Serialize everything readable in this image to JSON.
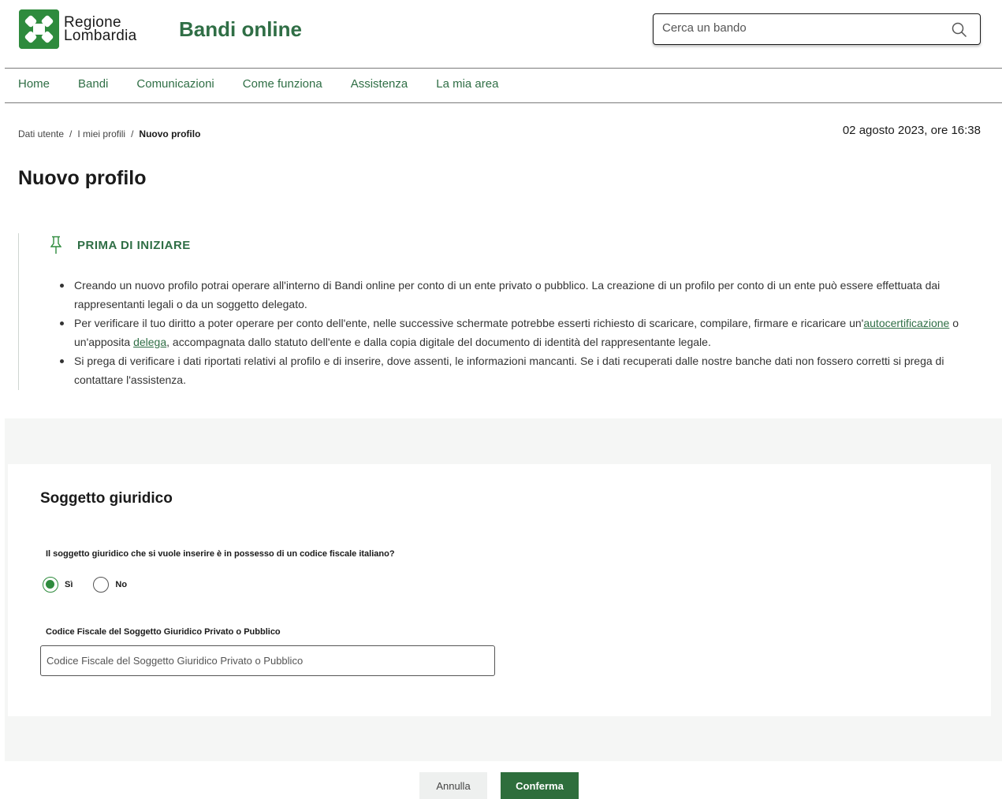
{
  "header": {
    "logo_line1": "Regione",
    "logo_line2": "Lombardia",
    "site_title": "Bandi online",
    "search_placeholder": "Cerca un bando"
  },
  "nav": {
    "items": [
      {
        "label": "Home"
      },
      {
        "label": "Bandi"
      },
      {
        "label": "Comunicazioni"
      },
      {
        "label": "Come funziona"
      },
      {
        "label": "Assistenza"
      },
      {
        "label": "La mia area"
      }
    ]
  },
  "breadcrumb": {
    "items": [
      "Dati utente",
      "I miei profili",
      "Nuovo profilo"
    ],
    "separator": "/"
  },
  "date": "02 agosto 2023, ore 16:38",
  "page_title": "Nuovo profilo",
  "info": {
    "title": "PRIMA DI INIZIARE",
    "item1": "Creando un nuovo profilo potrai operare all'interno di Bandi online per conto di un ente privato o pubblico. La creazione di un profilo per conto di un ente può essere effettuata dai rappresentanti legali o da un soggetto delegato.",
    "item2_a": "Per verificare il tuo diritto a poter operare per conto dell'ente, nelle successive schermate potrebbe esserti richiesto di scaricare, compilare, firmare e ricaricare un'",
    "item2_link1": "autocertificazione",
    "item2_b": " o un'apposita ",
    "item2_link2": "delega",
    "item2_c": ", accompagnata dallo statuto dell'ente e dalla copia digitale del documento di identità del rappresentante legale.",
    "item3": "Si prega di verificare i dati riportati relativi al profilo e di inserire, dove assenti, le informazioni mancanti. Se i dati recuperati dalle nostre banche dati non fossero corretti si prega di contattare l'assistenza."
  },
  "form": {
    "card_title": "Soggetto giuridico",
    "question": "Il soggetto giuridico che si vuole inserire è in possesso di un codice fiscale italiano?",
    "radio_yes": "Sì",
    "radio_no": "No",
    "selected": "Sì",
    "field_label": "Codice Fiscale del Soggetto Giuridico Privato o Pubblico",
    "field_placeholder": "Codice Fiscale del Soggetto Giuridico Privato o Pubblico",
    "field_value": ""
  },
  "buttons": {
    "cancel": "Annulla",
    "confirm": "Conferma"
  },
  "colors": {
    "brand_green": "#2e8b3d",
    "link_green": "#2f6e45",
    "confirm_bg": "#2e6e3c"
  }
}
